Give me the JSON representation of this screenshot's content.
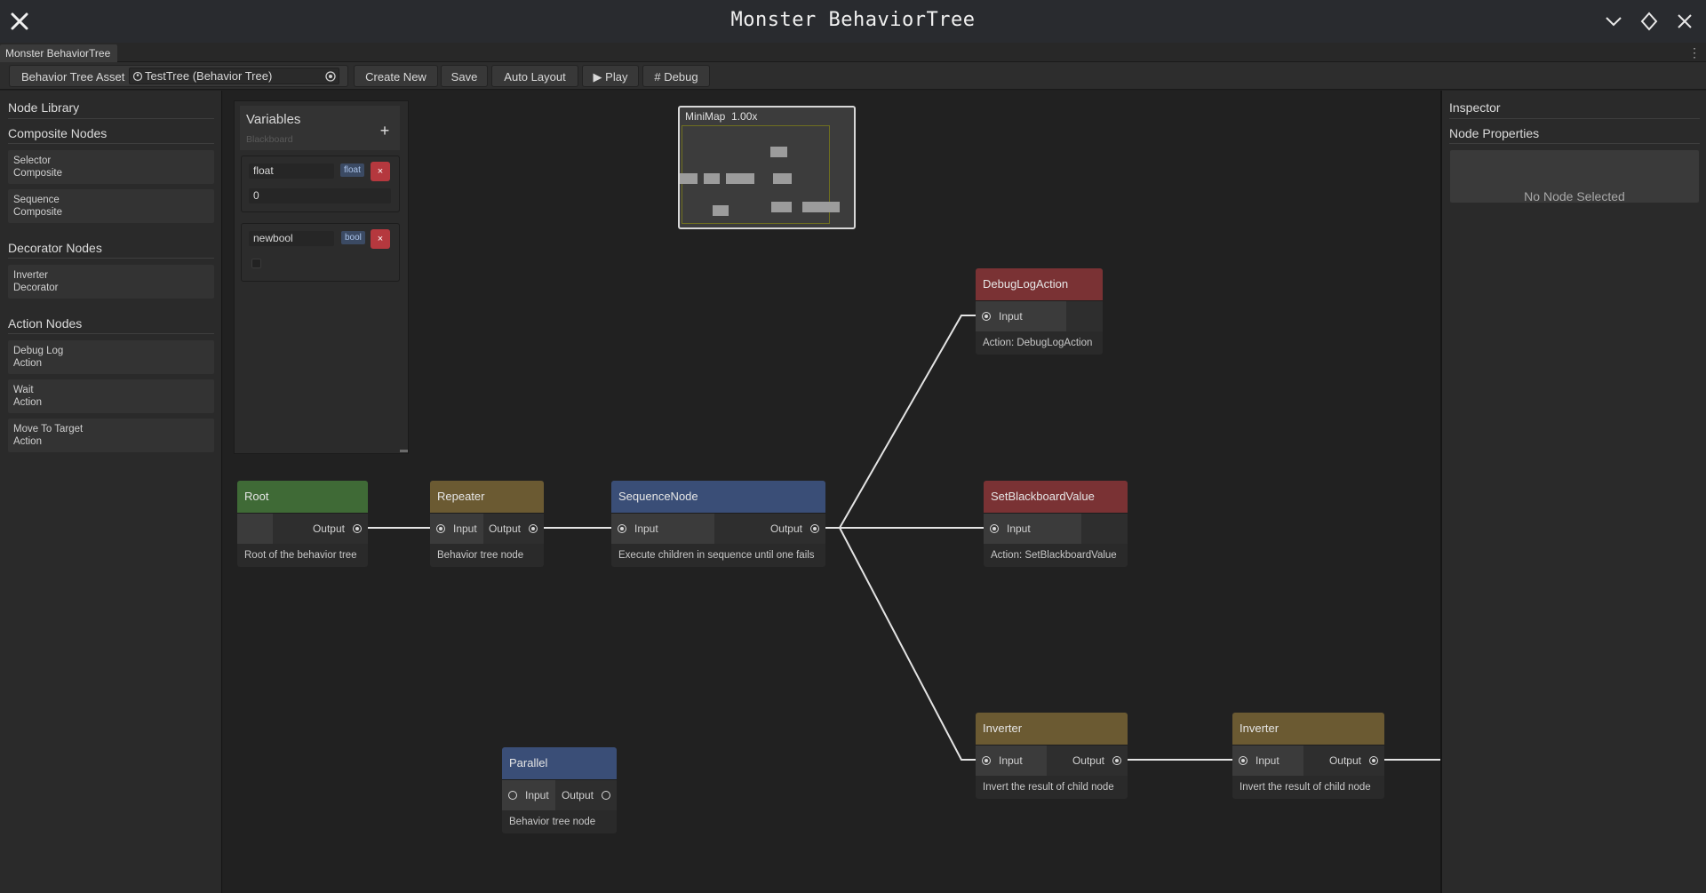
{
  "window": {
    "title": "Monster BehaviorTree",
    "tab_label": "Monster BehaviorTree",
    "tab_menu_glyph": "⋮"
  },
  "toolbar": {
    "asset_label": "Behavior Tree Asset",
    "asset_value": "TestTree (Behavior Tree)",
    "create_new": "Create New",
    "save": "Save",
    "auto_layout": "Auto Layout",
    "play": "▶ Play",
    "debug": "# Debug"
  },
  "library": {
    "title": "Node Library",
    "composite_title": "Composite Nodes",
    "composite_items": [
      {
        "name": "Selector",
        "type": "Composite"
      },
      {
        "name": "Sequence",
        "type": "Composite"
      }
    ],
    "decorator_title": "Decorator Nodes",
    "decorator_items": [
      {
        "name": "Inverter",
        "type": "Decorator"
      }
    ],
    "action_title": "Action Nodes",
    "action_items": [
      {
        "name": "Debug Log",
        "type": "Action"
      },
      {
        "name": "Wait",
        "type": "Action"
      },
      {
        "name": "Move To Target",
        "type": "Action"
      }
    ]
  },
  "blackboard": {
    "title": "Variables",
    "subtitle": "Blackboard",
    "add_glyph": "+",
    "variables": [
      {
        "name": "float",
        "type": "float",
        "value": "0",
        "delete_glyph": "×"
      },
      {
        "name": "newbool",
        "type": "bool",
        "value": false,
        "delete_glyph": "×"
      }
    ]
  },
  "minimap": {
    "title": "MiniMap",
    "zoom": "1.00x"
  },
  "inspector": {
    "title": "Inspector",
    "properties_title": "Node Properties",
    "empty_text": "No Node Selected"
  },
  "nodes": {
    "root": {
      "title": "Root",
      "output": "Output",
      "desc": "Root of the behavior tree"
    },
    "repeater": {
      "title": "Repeater",
      "input": "Input",
      "output": "Output",
      "desc": "Behavior tree node"
    },
    "sequence": {
      "title": "SequenceNode",
      "input": "Input",
      "output": "Output",
      "desc": "Execute children in sequence until one fails"
    },
    "debuglog": {
      "title": "DebugLogAction",
      "input": "Input",
      "desc": "Action: DebugLogAction"
    },
    "setbb": {
      "title": "SetBlackboardValue",
      "input": "Input",
      "desc": "Action: SetBlackboardValue"
    },
    "inverter1": {
      "title": "Inverter",
      "input": "Input",
      "output": "Output",
      "desc": "Invert the result of child node"
    },
    "inverter2": {
      "title": "Inverter",
      "input": "Input",
      "output": "Output",
      "desc": "Invert the result of child node"
    },
    "parallel": {
      "title": "Parallel",
      "input": "Input",
      "output": "Output",
      "desc": "Behavior tree node"
    }
  },
  "colors": {
    "composite_blue": "#3a4e77",
    "decorator_olive": "#6b5a32",
    "action_red": "#7a3234",
    "root_green": "#3f6a36",
    "delete_red": "#b5383e"
  }
}
